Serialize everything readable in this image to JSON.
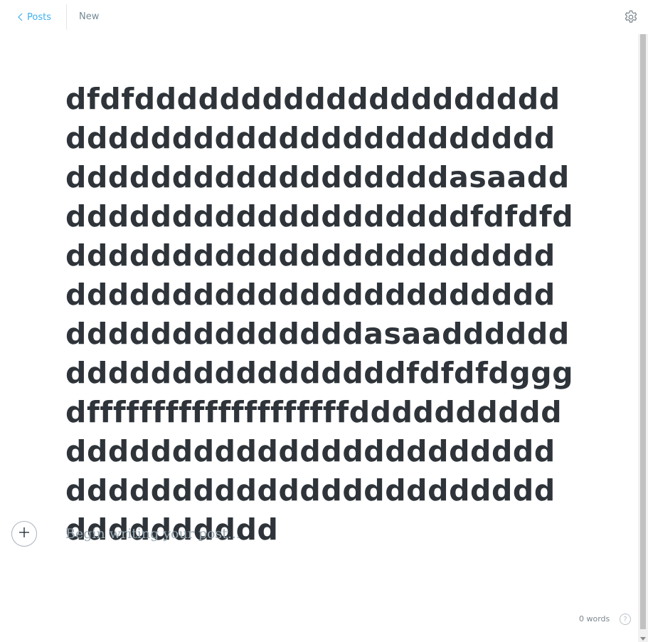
{
  "header": {
    "back_label": "Posts",
    "status": "New",
    "back_icon": "chevron-left-icon",
    "settings_icon": "gear-icon"
  },
  "post": {
    "title": "dfdfdddddddddddddddddddddddddddddddddddddddddddddddddddddddddddddasaadddddddddddddddddddddfdfdfdddddddddddddddddddddddddddddddddddddddddddddddddddddddddddddasaaddddddddddddddddddddddfdfdfdgggdffffffffffffffffffffdddddddddddddddddddddddddddddddddddddddddddddddddddddddddddddddddd",
    "body_placeholder": "Begin writing your post..."
  },
  "footer": {
    "word_count": "0 words",
    "help_icon": "question-mark-icon",
    "help_glyph": "?"
  },
  "colors": {
    "accent": "#3eb0ef",
    "title_text": "#2e3439",
    "placeholder": "#99a9b3",
    "muted": "#738a94"
  }
}
